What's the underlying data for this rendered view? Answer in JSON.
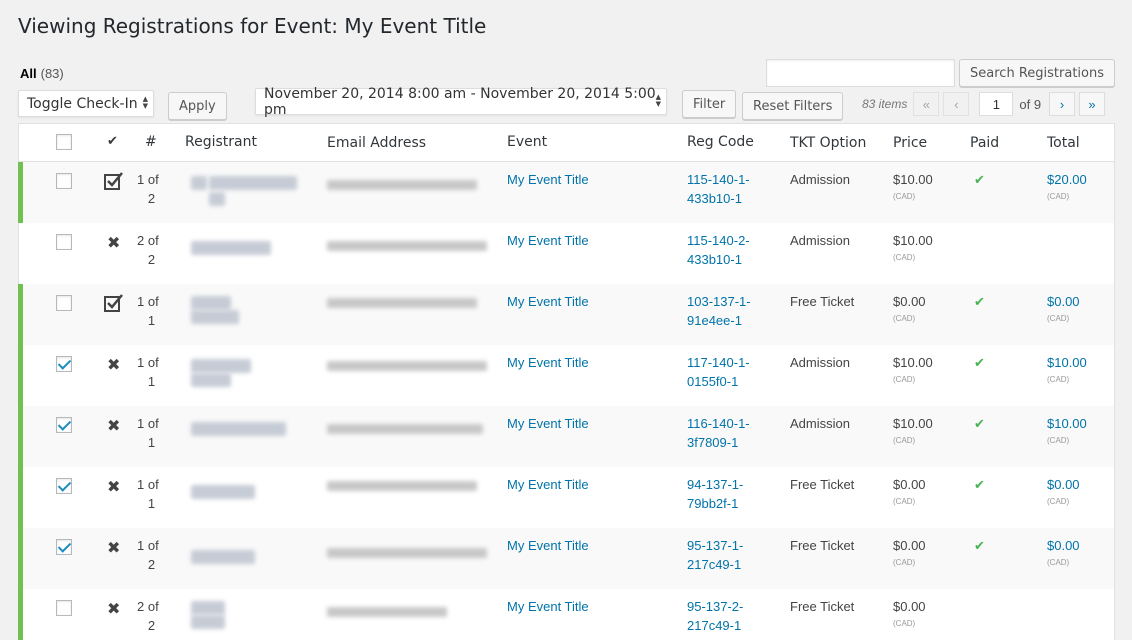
{
  "page": {
    "title": "Viewing Registrations for Event: My Event Title"
  },
  "views": {
    "all_label": "All",
    "all_count": "(83)"
  },
  "search": {
    "button": "Search Registrations",
    "placeholder": ""
  },
  "bulk": {
    "selected": "Toggle Check-In",
    "apply": "Apply"
  },
  "datetime": {
    "selected": "November 20, 2014 8:00 am - November 20, 2014 5:00 pm"
  },
  "filters": {
    "filter": "Filter",
    "reset": "Reset Filters"
  },
  "pagination": {
    "items": "83 items",
    "first": "«",
    "prev": "‹",
    "current": "1",
    "of_pages": "of 9",
    "next": "›",
    "last": "»"
  },
  "columns": {
    "checkin": "✔",
    "num": "#",
    "registrant": "Registrant",
    "email": "Email Address",
    "event": "Event",
    "reg_code": "Reg Code",
    "tkt": "TKT Option",
    "price": "Price",
    "paid": "Paid",
    "total": "Total"
  },
  "colors": {
    "accent": "#0073aa",
    "approved": "#70c14f",
    "paid": "#46b450"
  },
  "rows": [
    {
      "checked": false,
      "checkin": "checked-in",
      "num_a": "1 of",
      "num_b": "2",
      "event": "My Event Title",
      "code_a": "115-140-1-",
      "code_b": "433b10-1",
      "tkt": "Admission",
      "price": "$10.00",
      "price_cur": "(CAD)",
      "paid": true,
      "total": "$20.00",
      "total_cur": "(CAD)",
      "approved": true
    },
    {
      "checked": false,
      "checkin": "not-checked-in",
      "num_a": "2 of",
      "num_b": "2",
      "event": "My Event Title",
      "code_a": "115-140-2-",
      "code_b": "433b10-1",
      "tkt": "Admission",
      "price": "$10.00",
      "price_cur": "(CAD)",
      "paid": false,
      "total": "",
      "total_cur": "",
      "approved": false
    },
    {
      "checked": false,
      "checkin": "checked-in",
      "num_a": "1 of",
      "num_b": "1",
      "event": "My Event Title",
      "code_a": "103-137-1-",
      "code_b": "91e4ee-1",
      "tkt": "Free Ticket",
      "price": "$0.00",
      "price_cur": "(CAD)",
      "paid": true,
      "total": "$0.00",
      "total_cur": "(CAD)",
      "approved": true
    },
    {
      "checked": true,
      "checkin": "not-checked-in",
      "num_a": "1 of",
      "num_b": "1",
      "event": "My Event Title",
      "code_a": "117-140-1-",
      "code_b": "0155f0-1",
      "tkt": "Admission",
      "price": "$10.00",
      "price_cur": "(CAD)",
      "paid": true,
      "total": "$10.00",
      "total_cur": "(CAD)",
      "approved": true
    },
    {
      "checked": true,
      "checkin": "not-checked-in",
      "num_a": "1 of",
      "num_b": "1",
      "event": "My Event Title",
      "code_a": "116-140-1-",
      "code_b": "3f7809-1",
      "tkt": "Admission",
      "price": "$10.00",
      "price_cur": "(CAD)",
      "paid": true,
      "total": "$10.00",
      "total_cur": "(CAD)",
      "approved": true
    },
    {
      "checked": true,
      "checkin": "not-checked-in",
      "num_a": "1 of",
      "num_b": "1",
      "event": "My Event Title",
      "code_a": "94-137-1-",
      "code_b": "79bb2f-1",
      "tkt": "Free Ticket",
      "price": "$0.00",
      "price_cur": "(CAD)",
      "paid": true,
      "total": "$0.00",
      "total_cur": "(CAD)",
      "approved": true
    },
    {
      "checked": true,
      "checkin": "not-checked-in",
      "num_a": "1 of",
      "num_b": "2",
      "event": "My Event Title",
      "code_a": "95-137-1-",
      "code_b": "217c49-1",
      "tkt": "Free Ticket",
      "price": "$0.00",
      "price_cur": "(CAD)",
      "paid": true,
      "total": "$0.00",
      "total_cur": "(CAD)",
      "approved": true
    },
    {
      "checked": false,
      "checkin": "not-checked-in",
      "num_a": "2 of",
      "num_b": "2",
      "event": "My Event Title",
      "code_a": "95-137-2-",
      "code_b": "217c49-1",
      "tkt": "Free Ticket",
      "price": "$0.00",
      "price_cur": "(CAD)",
      "paid": false,
      "total": "",
      "total_cur": "",
      "approved": true
    }
  ]
}
